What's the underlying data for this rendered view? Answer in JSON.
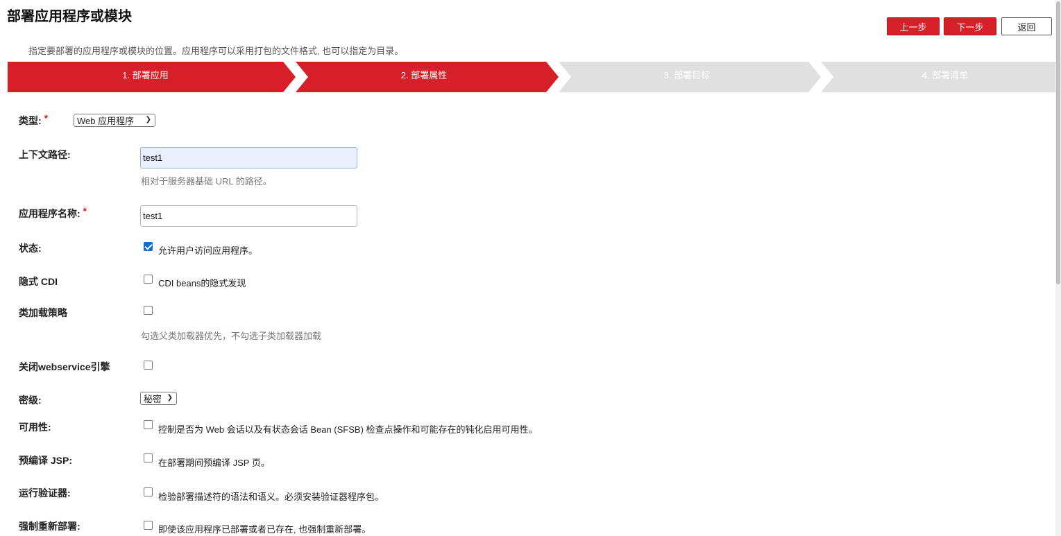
{
  "page": {
    "title": "部署应用程序或模块",
    "subtitle": "指定要部署的应用程序或模块的位置。应用程序可以采用打包的文件格式, 也可以指定为目录。"
  },
  "toolbar": {
    "prev_label": "上一步",
    "next_label": "下一步",
    "back_label": "返回"
  },
  "steps": [
    {
      "label": "1. 部署应用",
      "state": "done"
    },
    {
      "label": "2. 部署属性",
      "state": "current"
    },
    {
      "label": "3. 部署目标",
      "state": "pending"
    },
    {
      "label": "4. 部署清单",
      "state": "pending"
    }
  ],
  "form": {
    "type": {
      "label": "类型:",
      "value": "Web 应用程序"
    },
    "context_path": {
      "label": "上下文路径:",
      "value": "test1",
      "hint": "相对于服务器基础 URL 的路径。"
    },
    "app_name": {
      "label": "应用程序名称:",
      "value": "test1"
    },
    "status": {
      "label": "状态:",
      "checked": true,
      "text": "允许用户访问应用程序。"
    },
    "implicit_cdi": {
      "label": "隐式 CDI",
      "checked": false,
      "text": "CDI beans的隐式发现"
    },
    "classloader": {
      "label": "类加载策略",
      "checked": false,
      "hint": "勾选父类加载器优先，不勾选子类加载器加载"
    },
    "webservice": {
      "label": "关闭webservice引擎",
      "checked": false
    },
    "security": {
      "label": "密级:",
      "value": "秘密"
    },
    "availability": {
      "label": "可用性:",
      "checked": false,
      "text": "控制是否为 Web 会话以及有状态会话 Bean (SFSB) 检查点操作和可能存在的钝化启用可用性。"
    },
    "precompile": {
      "label": "预编译 JSP:",
      "checked": false,
      "text": "在部署期间预编译 JSP 页。"
    },
    "verifier": {
      "label": "运行验证器:",
      "checked": false,
      "text": "检验部署描述符的语法和语义。必须安装验证器程序包。"
    },
    "force_redeploy": {
      "label": "强制重新部署:",
      "checked": false,
      "text": "即使该应用程序已部署或者已存在, 也强制重新部署。"
    }
  },
  "required_mark": "*",
  "colors": {
    "accent": "#d71f29",
    "step_inactive": "#e0e0e0"
  }
}
